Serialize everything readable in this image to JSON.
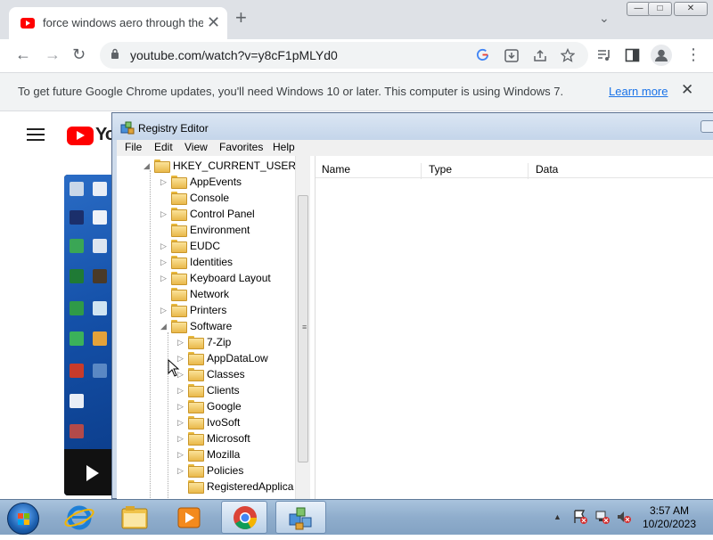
{
  "browser": {
    "tab": {
      "title": "force windows aero through the",
      "close_glyph": "✕"
    },
    "new_tab_glyph": "+",
    "tab_search_glyph": "⌄",
    "window_controls": {
      "minimize": "—",
      "maximize": "□",
      "close": "✕"
    },
    "toolbar": {
      "back_glyph": "←",
      "forward_glyph": "→",
      "reload_glyph": "↻",
      "url": "youtube.com/watch?v=y8cF1pMLYd0",
      "menu_glyph": "⋮"
    },
    "infobar": {
      "message": "To get future Google Chrome updates, you'll need Windows 10 or later. This computer is using Windows 7.",
      "link": "Learn more",
      "close_glyph": "✕"
    }
  },
  "youtube": {
    "logo_text": "Yo"
  },
  "regedit": {
    "title": "Registry Editor",
    "menu": [
      "File",
      "Edit",
      "View",
      "Favorites",
      "Help"
    ],
    "tree": {
      "root": "HKEY_CURRENT_USER",
      "level1": [
        "AppEvents",
        "Console",
        "Control Panel",
        "Environment",
        "EUDC",
        "Identities",
        "Keyboard Layout",
        "Network",
        "Printers",
        "Software"
      ],
      "software_children": [
        "7-Zip",
        "AppDataLow",
        "Classes",
        "Clients",
        "Google",
        "IvoSoft",
        "Microsoft",
        "Mozilla",
        "Policies",
        "RegisteredApplica"
      ]
    },
    "columns": {
      "name": "Name",
      "type": "Type",
      "data": "Data"
    }
  },
  "taskbar": {
    "time": "3:57 AM",
    "date": "10/20/2023",
    "tray_arrow": "▲"
  }
}
